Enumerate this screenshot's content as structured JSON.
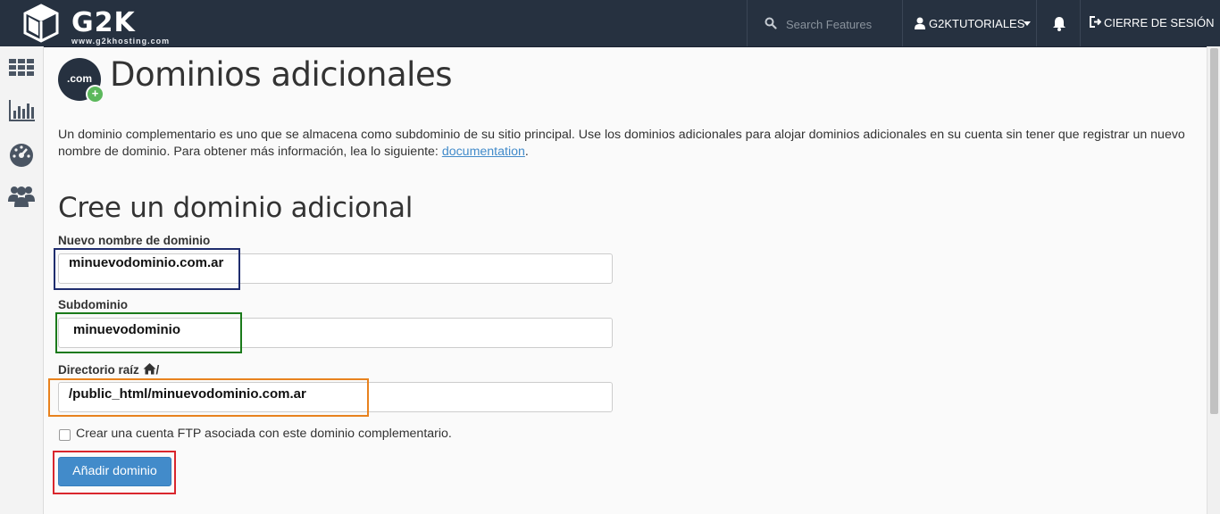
{
  "brand": {
    "logo_text": "G2K",
    "logo_sub": "www.g2khosting.com"
  },
  "topbar": {
    "search_placeholder": "Search Features",
    "username": "G2KTUTORIALES",
    "logout_label": "CIERRE DE SESIÓN"
  },
  "sidebar": {
    "items": [
      {
        "icon": "grid-icon"
      },
      {
        "icon": "bar-chart-icon"
      },
      {
        "icon": "dashboard-gauge-icon"
      },
      {
        "icon": "users-icon"
      }
    ]
  },
  "page": {
    "icon_text": ".com",
    "title": "Dominios adicionales",
    "description_text": "Un dominio complementario es uno que se almacena como subdominio de su sitio principal. Use los dominios adicionales para alojar dominios adicionales en su cuenta sin tener que registrar un nuevo nombre de dominio. Para obtener más información, lea lo siguiente: ",
    "description_link": "documentation",
    "description_end": "."
  },
  "form": {
    "title": "Cree un dominio adicional",
    "domain_label": "Nuevo nombre de dominio",
    "domain_value": "minuevodominio.com.ar",
    "subdomain_label": "Subdominio",
    "subdomain_value": "minuevodominio",
    "root_label": "Directorio raíz",
    "root_suffix": "/",
    "root_value": "/public_html/minuevodominio.com.ar",
    "ftp_checkbox_label": "Crear una cuenta FTP asociada con este dominio complementario.",
    "ftp_checked": false,
    "submit_label": "Añadir dominio"
  },
  "highlight_colors": {
    "domain": "#1f2d6e",
    "subdomain": "#1a7a1a",
    "root": "#e8821e",
    "submit": "#d9262d"
  }
}
